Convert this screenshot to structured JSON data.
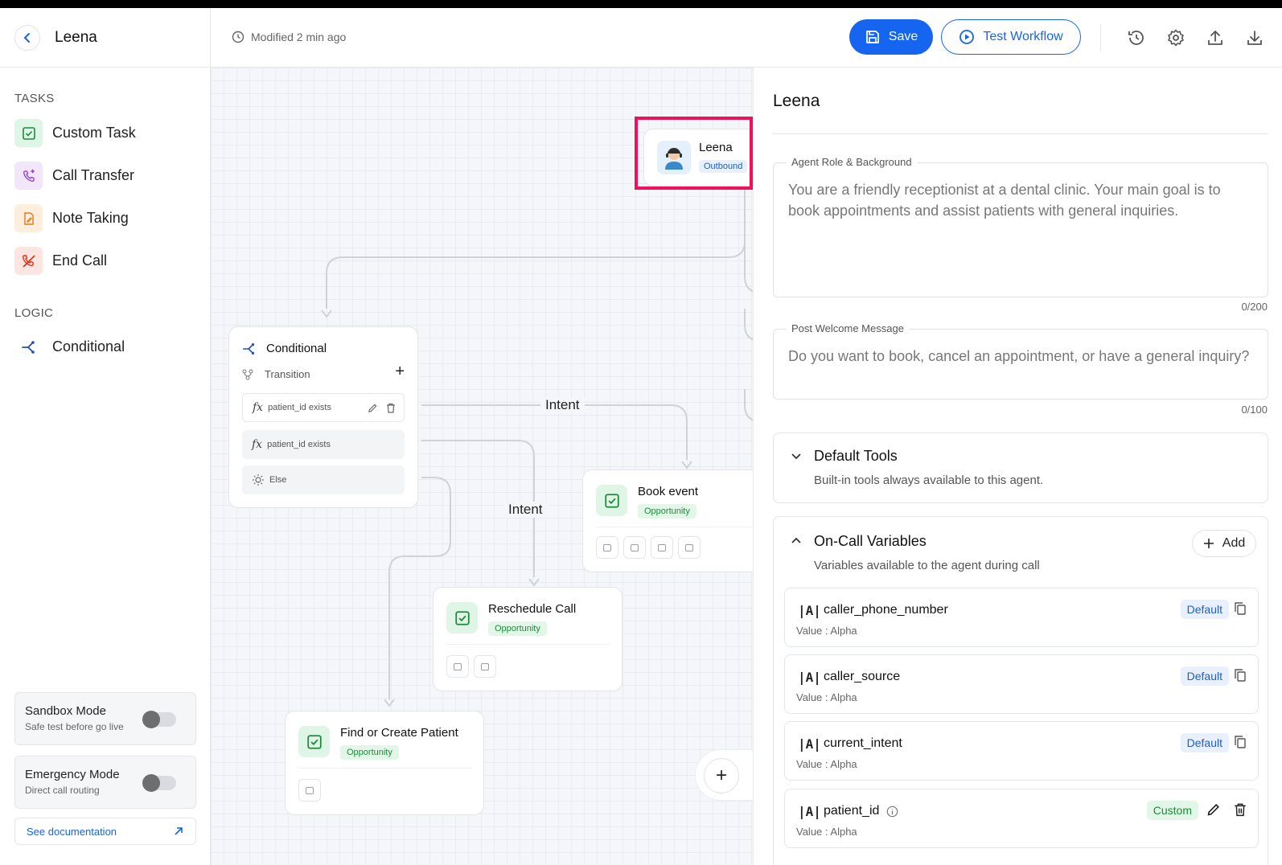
{
  "header": {
    "app_name": "Leena",
    "modified": "Modified 2 min ago",
    "save_label": "Save",
    "test_label": "Test Workflow",
    "icons": [
      "history-icon",
      "settings-icon",
      "upload-icon",
      "download-icon"
    ]
  },
  "sidebar": {
    "tasks_label": "TASKS",
    "tasks": [
      {
        "label": "Custom Task",
        "icon": "check-square-icon",
        "color": "#1f8a3d",
        "bg": "#dff5e5"
      },
      {
        "label": "Call Transfer",
        "icon": "phone-transfer-icon",
        "color": "#8e3bd6",
        "bg": "#f2e6fb"
      },
      {
        "label": "Note Taking",
        "icon": "note-icon",
        "color": "#e07b1a",
        "bg": "#fdeedd"
      },
      {
        "label": "End Call",
        "icon": "end-call-icon",
        "color": "#e0321a",
        "bg": "#fde6e1"
      }
    ],
    "logic_label": "LOGIC",
    "logic": [
      {
        "label": "Conditional",
        "icon": "branch-icon",
        "color": "#1f4fc8"
      }
    ],
    "sandbox": {
      "title": "Sandbox Mode",
      "subtitle": "Safe test before go live",
      "enabled": false
    },
    "emergency": {
      "title": "Emergency Mode",
      "subtitle": "Direct call routing",
      "enabled": false
    },
    "docs_label": "See documentation"
  },
  "canvas": {
    "agent_node": {
      "name": "Leena",
      "badge": "Outbound"
    },
    "conditional_node": {
      "title": "Conditional",
      "transition_label": "Transition",
      "rows": [
        "patient_id exists",
        "patient_id exists",
        "Else"
      ]
    },
    "edge_labels": [
      "Intent",
      "Intent"
    ],
    "task_nodes": [
      {
        "title": "Book event",
        "badge": "Opportunity"
      },
      {
        "title": "Reschedule Call",
        "badge": "Opportunity"
      },
      {
        "title": "Find or Create Patient",
        "badge": "Opportunity"
      }
    ]
  },
  "panel": {
    "title": "Leena",
    "role": {
      "legend": "Agent Role & Background",
      "value": "You are a friendly receptionist at a dental clinic. Your main goal is to book appointments and assist patients with general inquiries.",
      "counter": "0/200"
    },
    "welcome": {
      "legend": "Post Welcome Message",
      "value": "Do you want to book, cancel an appointment, or have a general inquiry?",
      "counter": "0/100"
    },
    "default_tools": {
      "title": "Default Tools",
      "subtitle": "Built-in tools always available to this agent."
    },
    "variables": {
      "title": "On-Call Variables",
      "subtitle": "Variables available to the agent during call",
      "add_label": "Add",
      "items": [
        {
          "name": "caller_phone_number",
          "value": "Value : Alpha",
          "tag": "Default"
        },
        {
          "name": "caller_source",
          "value": "Value : Alpha",
          "tag": "Default"
        },
        {
          "name": "current_intent",
          "value": "Value : Alpha",
          "tag": "Default"
        },
        {
          "name": "patient_id",
          "value": "Value : Alpha",
          "tag": "Custom"
        }
      ]
    }
  }
}
